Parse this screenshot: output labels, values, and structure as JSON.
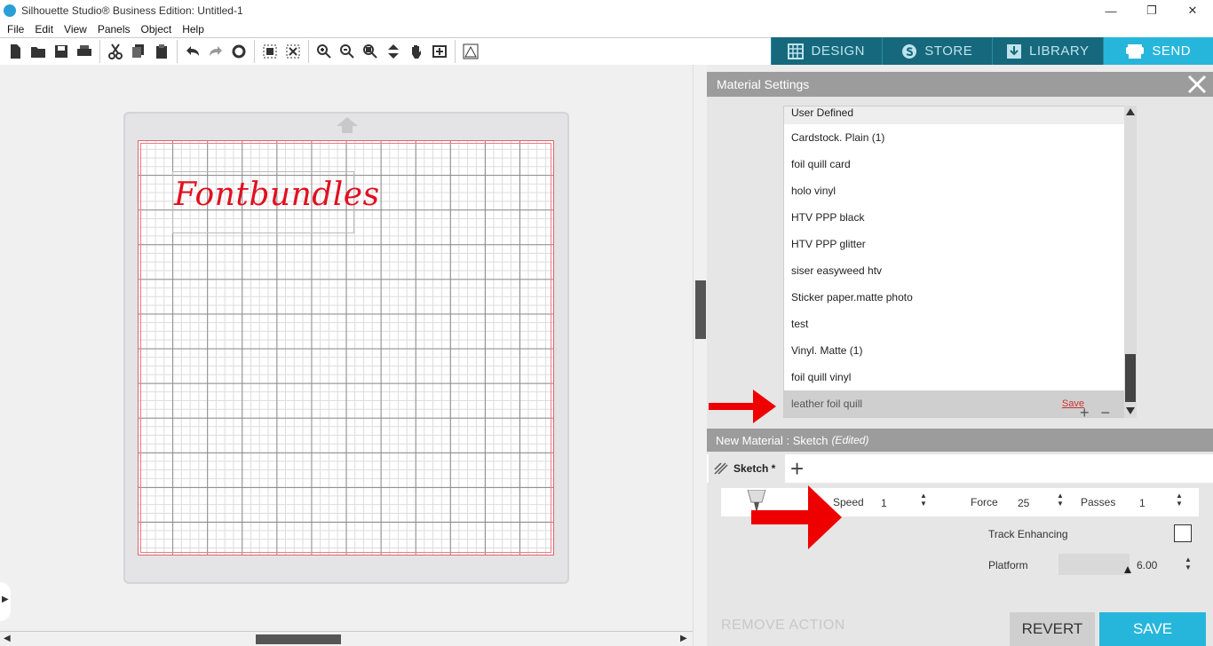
{
  "window": {
    "title": "Silhouette Studio® Business Edition: Untitled-1",
    "minimize": "—",
    "restore": "❐",
    "close": "✕"
  },
  "menu": [
    "File",
    "Edit",
    "View",
    "Panels",
    "Object",
    "Help"
  ],
  "nav": {
    "design": "DESIGN",
    "store": "STORE",
    "library": "LIBRARY",
    "send": "SEND",
    "active": "send"
  },
  "canvas": {
    "text": "Fontbundles",
    "text_color": "#e01020"
  },
  "material_settings": {
    "title": "Material Settings",
    "items": [
      "User Defined",
      "Cardstock. Plain (1)",
      "foil quill card",
      "holo vinyl",
      "HTV PPP black",
      "HTV PPP glitter",
      "siser easyweed htv",
      "Sticker paper.matte photo",
      "test",
      "Vinyl. Matte (1)",
      "foil quill vinyl",
      "leather foil quill"
    ],
    "selected": "leather foil quill",
    "save_label": "Save",
    "add": "+",
    "remove": "−"
  },
  "new_material": {
    "title": "New Material : Sketch",
    "edited": "(Edited)",
    "tab_label": "Sketch *",
    "add_tab": "+",
    "speed_label": "Speed",
    "speed_value": "1",
    "force_label": "Force",
    "force_value": "25",
    "passes_label": "Passes",
    "passes_value": "1",
    "track_label": "Track Enhancing",
    "track_checked": false,
    "platform_label": "Platform",
    "platform_value": "6.00"
  },
  "footer": {
    "remove_action": "REMOVE ACTION",
    "revert": "REVERT",
    "save": "SAVE"
  },
  "colors": {
    "accent": "#27b6db",
    "nav_bg": "#16697d",
    "annotation_arrow": "#ee0000"
  }
}
